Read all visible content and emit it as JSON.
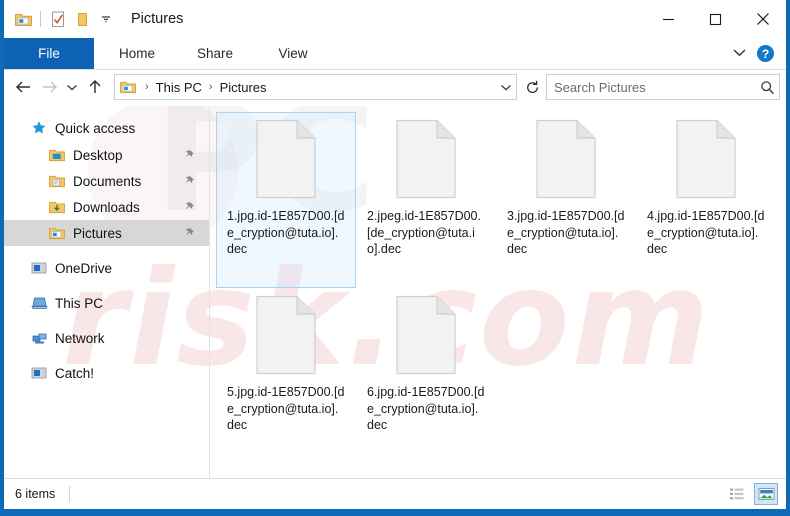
{
  "window": {
    "title": "Pictures",
    "accent_color": "#0d6ab8",
    "frame_color": "#0d6ab8"
  },
  "quick_access_toolbar": {
    "items": [
      {
        "name": "folder-icon",
        "label": "Pictures"
      },
      {
        "name": "properties-icon",
        "label": "Properties"
      },
      {
        "name": "new-folder-icon",
        "label": "New folder"
      },
      {
        "name": "chevron-down-icon",
        "label": "Customize Quick Access Toolbar"
      }
    ]
  },
  "window_controls": {
    "minimize": "–",
    "maximize": "☐",
    "close": "✕"
  },
  "ribbon": {
    "tabs": [
      {
        "label": "File",
        "active": true
      },
      {
        "label": "Home",
        "active": false
      },
      {
        "label": "Share",
        "active": false
      },
      {
        "label": "View",
        "active": false
      }
    ],
    "collapse_label": "⌄",
    "help_label": "?"
  },
  "address_bar": {
    "back_label": "←",
    "forward_label": "→",
    "recent_label": "⌄",
    "up_label": "↑",
    "breadcrumb": [
      "This PC",
      "Pictures"
    ],
    "separator": "›",
    "dropdown_label": "⌄",
    "refresh_label": "↻"
  },
  "search": {
    "placeholder": "Search Pictures",
    "value": "",
    "icon": "search-icon"
  },
  "sidebar": {
    "items": [
      {
        "label": "Quick access",
        "icon": "star-icon",
        "level": 0,
        "pinned": false,
        "selected": false
      },
      {
        "label": "Desktop",
        "icon": "folder-desktop-icon",
        "level": 1,
        "pinned": true,
        "selected": false
      },
      {
        "label": "Documents",
        "icon": "folder-documents-icon",
        "level": 1,
        "pinned": true,
        "selected": false
      },
      {
        "label": "Downloads",
        "icon": "folder-downloads-icon",
        "level": 1,
        "pinned": true,
        "selected": false
      },
      {
        "label": "Pictures",
        "icon": "folder-pictures-icon",
        "level": 1,
        "pinned": true,
        "selected": true
      },
      {
        "label": "OneDrive",
        "icon": "onedrive-icon",
        "level": 0,
        "pinned": false,
        "selected": false,
        "gap_before": true
      },
      {
        "label": "This PC",
        "icon": "this-pc-icon",
        "level": 0,
        "pinned": false,
        "selected": false,
        "gap_before": true
      },
      {
        "label": "Network",
        "icon": "network-icon",
        "level": 0,
        "pinned": false,
        "selected": false,
        "gap_before": true
      },
      {
        "label": "Catch!",
        "icon": "drive-icon",
        "level": 0,
        "pinned": false,
        "selected": false,
        "gap_before": true
      }
    ]
  },
  "files": [
    {
      "name": "1.jpg.id-1E857D00.[de_cryption@tuta.io].dec",
      "icon": "blank-document-icon",
      "selected": true
    },
    {
      "name": "2.jpeg.id-1E857D00.[de_cryption@tuta.io].dec",
      "icon": "blank-document-icon",
      "selected": false
    },
    {
      "name": "3.jpg.id-1E857D00.[de_cryption@tuta.io].dec",
      "icon": "blank-document-icon",
      "selected": false
    },
    {
      "name": "4.jpg.id-1E857D00.[de_cryption@tuta.io].dec",
      "icon": "blank-document-icon",
      "selected": false
    },
    {
      "name": "5.jpg.id-1E857D00.[de_cryption@tuta.io].dec",
      "icon": "blank-document-icon",
      "selected": false
    },
    {
      "name": "6.jpg.id-1E857D00.[de_cryption@tuta.io].dec",
      "icon": "blank-document-icon",
      "selected": false
    }
  ],
  "status_bar": {
    "item_count_text": "6 items",
    "views": [
      {
        "name": "details-view-button",
        "active": false
      },
      {
        "name": "large-icons-view-button",
        "active": true
      }
    ]
  },
  "watermark": {
    "line1": "risk.com",
    "line2": "PC"
  }
}
